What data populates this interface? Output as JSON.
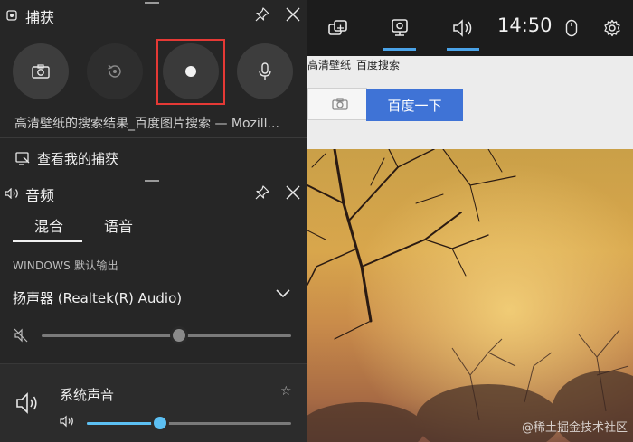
{
  "topbar": {
    "clock": "14:50",
    "widget_icon": "widget-menu-icon",
    "capture_icon": "capture-icon",
    "audio_icon": "audio-icon",
    "mouse_icon": "mouse-icon",
    "settings_icon": "gear-icon"
  },
  "capture": {
    "title": "捕获",
    "buttons": [
      "camera-icon",
      "record-last-icon",
      "record-icon",
      "microphone-icon"
    ],
    "window_title": "高清壁纸的搜索结果_百度图片搜索 — Mozill...",
    "view_captures_label": "查看我的捕获"
  },
  "audio": {
    "title": "音频",
    "tabs": [
      "混合",
      "语音"
    ],
    "active_tab": "混合",
    "output_label": "WINDOWS 默认输出",
    "device": "扬声器 (Realtek(R) Audio)",
    "master_volume": 0.55,
    "system_sound_label": "系统声音",
    "system_volume": 0.36
  },
  "background_page": {
    "tab_title": "高清壁纸_百度搜索",
    "search_button": "百度一下",
    "watermark": "@稀土掘金技术社区"
  },
  "colors": {
    "accent": "#4aa3e8",
    "highlight": "#e53935",
    "search_blue": "#3f73d6"
  }
}
